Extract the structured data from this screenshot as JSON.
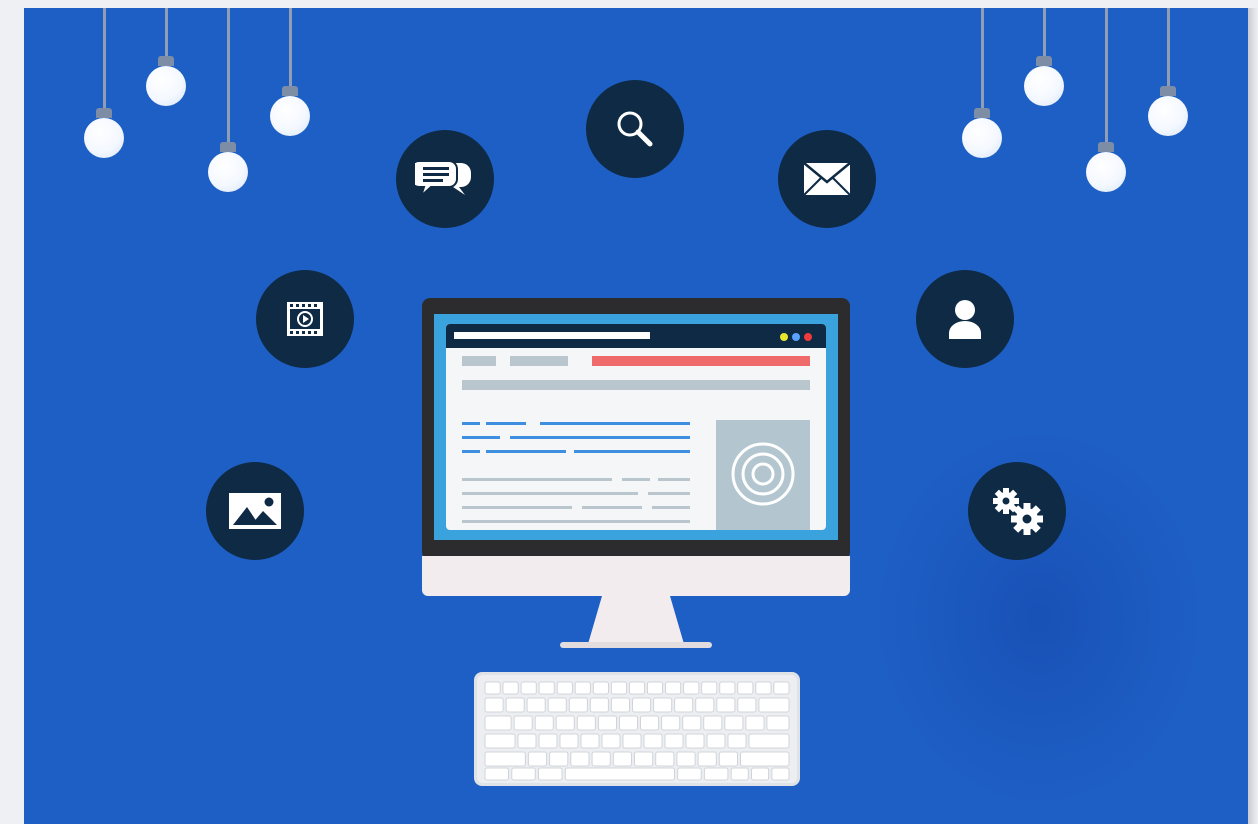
{
  "colors": {
    "background": "#1e5fc5",
    "icon_circle": "#0e2a44",
    "bulb_cord": "#8f9eb4",
    "monitor_bezel": "#2c2c2e",
    "screen_header": "#0e2a44",
    "accent_red": "#ef6a6a",
    "accent_blue": "#3f8fe0",
    "placeholder_gray": "#aebfc8",
    "keyboard": "#e9ebee"
  },
  "icons": [
    "chat-bubbles-icon",
    "search-icon",
    "envelope-icon",
    "video-film-icon",
    "user-icon",
    "image-icon",
    "gears-icon"
  ],
  "screen": {
    "window_dots": [
      "#e6e62f",
      "#5aa2ff",
      "#ef3b3b"
    ]
  }
}
